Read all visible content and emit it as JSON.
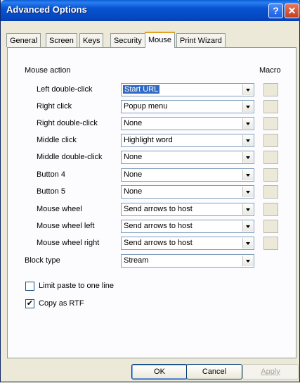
{
  "window": {
    "title": "Advanced Options",
    "help_glyph": "?",
    "close_glyph": "✕"
  },
  "tabs": [
    {
      "label": "General"
    },
    {
      "label": "Screen"
    },
    {
      "label": "Keys"
    },
    {
      "label": "Security"
    },
    {
      "label": "Mouse",
      "active": true
    },
    {
      "label": "Print Wizard"
    }
  ],
  "mouse_action": {
    "section_label": "Mouse action",
    "macro_header": "Macro",
    "rows": [
      {
        "label": "Left double-click",
        "value": "Start URL"
      },
      {
        "label": "Right click",
        "value": "Popup menu"
      },
      {
        "label": "Right double-click",
        "value": "None"
      },
      {
        "label": "Middle click",
        "value": "Highlight word"
      },
      {
        "label": "Middle double-click",
        "value": "None"
      },
      {
        "label": "Button 4",
        "value": "None"
      },
      {
        "label": "Button 5",
        "value": "None"
      },
      {
        "label": "Mouse wheel",
        "value": "Send arrows to host"
      },
      {
        "label": "Mouse wheel left",
        "value": "Send arrows to host"
      },
      {
        "label": "Mouse wheel right",
        "value": "Send arrows to host"
      }
    ]
  },
  "block_type": {
    "label": "Block type",
    "value": "Stream"
  },
  "checkboxes": {
    "limit_paste": {
      "label": "Limit paste to one line",
      "checked": false
    },
    "copy_rtf": {
      "label": "Copy as RTF",
      "checked": true,
      "mark": "✔"
    }
  },
  "buttons": {
    "ok": "OK",
    "cancel": "Cancel",
    "apply": "Apply"
  }
}
